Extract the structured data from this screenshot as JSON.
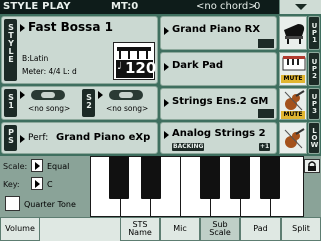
{
  "title_bar": {
    "mode": "STYLE PLAY",
    "mt": "MT:0",
    "chord": "<no chord>",
    "chord_value": "0"
  },
  "style": {
    "tab": "STYLE",
    "name": "Fast Bossa 1",
    "bank": "B:Latin",
    "meter": "Meter: 4/4  L: d",
    "tempo": "120"
  },
  "songs": {
    "s1_tab": "S1",
    "s1_song": "<no song>",
    "s2_tab": "S2",
    "s2_song": "<no song>"
  },
  "performance": {
    "tab": "PS",
    "label": "Perf:",
    "name": "Grand Piano eXp"
  },
  "upper_tracks": [
    {
      "name": "Grand Piano RX",
      "tab": "UP1",
      "status": "",
      "icon": "grand-piano-icon"
    },
    {
      "name": "Dark Pad",
      "tab": "UP2",
      "status": "MUTE",
      "icon": "keyboard-icon"
    },
    {
      "name": "Strings Ens.2 GM",
      "tab": "UP3",
      "status": "MUTE",
      "icon": "violin-icon"
    },
    {
      "name": "Analog Strings 2",
      "tab": "LOW",
      "status": "BACKING",
      "octave": "+1",
      "icon": "violin-icon"
    }
  ],
  "scale": {
    "scale_label": "Scale:",
    "scale_value": "Equal",
    "key_label": "Key:",
    "key_value": "C",
    "quarter_tone_label": "Quarter Tone"
  },
  "bottom_tabs": [
    {
      "label": "Volume"
    },
    {
      "label": "STS Name"
    },
    {
      "label": "Mic"
    },
    {
      "label": "Sub Scale"
    },
    {
      "label": "Pad"
    },
    {
      "label": "Split"
    }
  ],
  "colors": {
    "background": "#3f6f5f",
    "panel": "#cbd9d2",
    "title_bar": "#0e1c1a"
  }
}
